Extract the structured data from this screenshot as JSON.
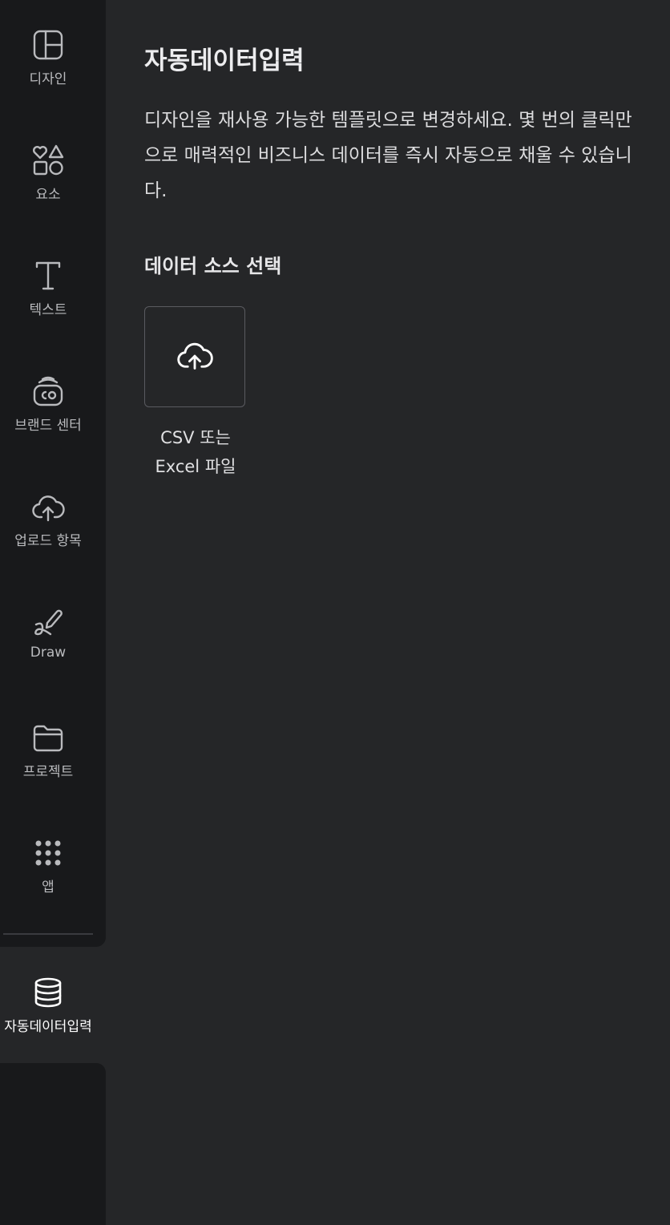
{
  "sidebar": {
    "items": [
      {
        "label": "디자인",
        "icon": "layout-icon"
      },
      {
        "label": "요소",
        "icon": "shapes-icon"
      },
      {
        "label": "텍스트",
        "icon": "text-icon"
      },
      {
        "label": "브랜드 센터",
        "icon": "brand-icon"
      },
      {
        "label": "업로드 항목",
        "icon": "cloud-upload-icon"
      },
      {
        "label": "Draw",
        "icon": "pen-icon"
      },
      {
        "label": "프로젝트",
        "icon": "folder-icon"
      },
      {
        "label": "앱",
        "icon": "grid-icon"
      }
    ],
    "active_item": {
      "label": "자동데이터입력",
      "icon": "database-icon"
    }
  },
  "panel": {
    "title": "자동데이터입력",
    "description": "디자인을 재사용 가능한 템플릿으로 변경하세요. 몇 번의 클릭만으로 매력적인 비즈니스 데이터를 즉시 자동으로 채울 수 있습니다.",
    "section_title": "데이터 소스 선택",
    "sources": [
      {
        "label": "CSV 또는\nExcel 파일",
        "icon": "cloud-upload-icon"
      }
    ]
  },
  "colors": {
    "background": "#252628",
    "sidebar": "#18191b",
    "text": "#e4e4e6"
  }
}
